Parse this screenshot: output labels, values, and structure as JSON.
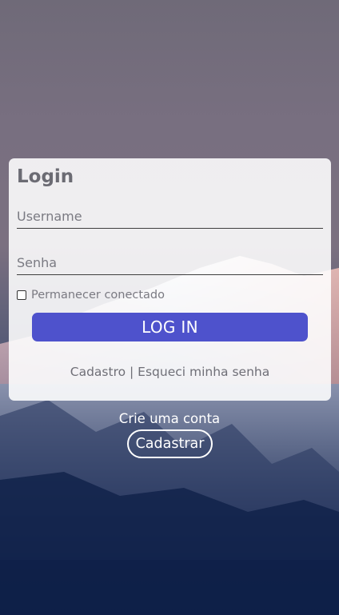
{
  "login": {
    "title": "Login",
    "username_placeholder": "Username",
    "password_placeholder": "Senha",
    "remember_label": "Permanecer conectado",
    "remember_checked": false,
    "login_button": "LOG IN",
    "link_register": "Cadastro",
    "link_separator": " | ",
    "link_forgot": "Esqueci minha senha"
  },
  "signup": {
    "prompt": "Crie uma conta",
    "button": "Cadastrar"
  },
  "colors": {
    "accent": "#4e52cc",
    "card": "#ffffff"
  }
}
